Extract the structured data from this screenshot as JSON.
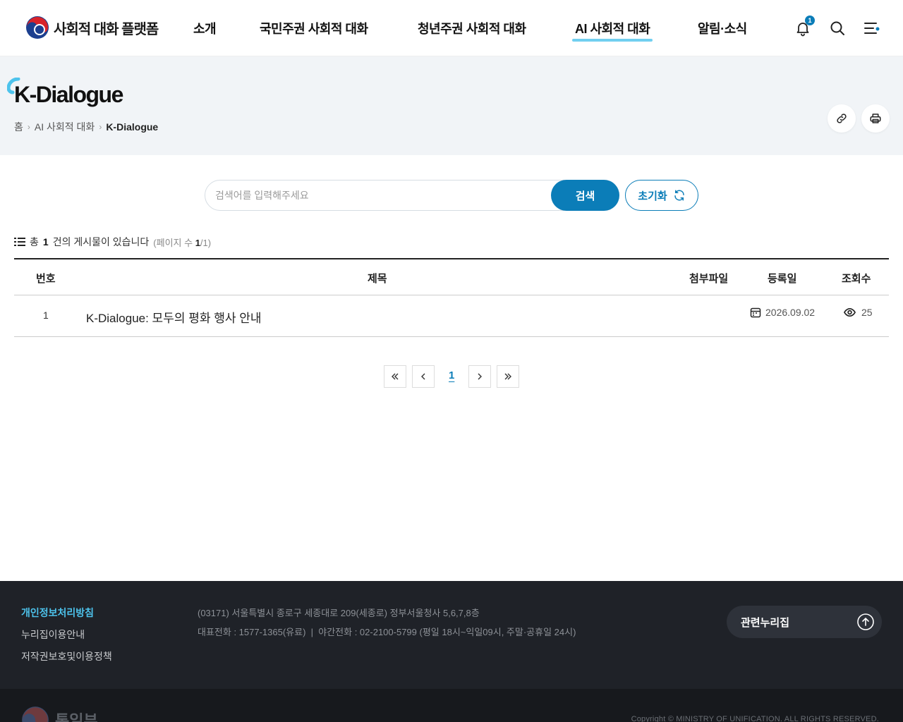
{
  "brand": {
    "title": "사회적 대화 플랫폼"
  },
  "nav": {
    "items": [
      "소개",
      "국민주권 사회적 대화",
      "청년주권 사회적 대화",
      "AI 사회적 대화",
      "알림·소식"
    ],
    "active": "AI 사회적 대화",
    "notification_count": "1"
  },
  "page": {
    "title": "K-Dialogue",
    "breadcrumb": [
      "홈",
      "AI 사회적 대화",
      "K-Dialogue"
    ]
  },
  "search": {
    "placeholder": "검색어를 입력해주세요",
    "value": "",
    "submit_label": "검색",
    "reset_label": "초기화"
  },
  "board": {
    "summary_prefix": "총",
    "total": "1",
    "summary_suffix": "건의 게시물이 있습니다",
    "page_prefix": "(페이지 수",
    "page_current": "1",
    "page_total": "/1)",
    "columns": [
      "번호",
      "제목",
      "첨부파일",
      "등록일",
      "조회수"
    ],
    "rows": [
      {
        "no": "1",
        "title": "K-Dialogue: 모두의 평화 행사 안내",
        "attachment": "",
        "date": "2026.09.02",
        "views": "25"
      }
    ]
  },
  "pagination": {
    "current": "1"
  },
  "footer": {
    "links": [
      "개인정보처리방침",
      "누리집이용안내",
      "저작권보호및이용정책"
    ],
    "address": "(03171) 서울특별시 종로구 세종대로 209(세종로) 정부서울청사 5,6,7,8층",
    "phone": "대표전화 : 1577-1365(유료)  |  야간전화 : 02-2100-5799 (평일 18시~익일09시, 주말·공휴일 24시)",
    "related_label": "관련누리집",
    "ministry": "통일부",
    "copyright": "Copyright © MINISTRY OF UNIFICATION. ALL RIGHTS RESERVED."
  },
  "colors": {
    "primary": "#0b7db8",
    "accent": "#4dc3ec",
    "footer_bg": "#1f2228"
  }
}
